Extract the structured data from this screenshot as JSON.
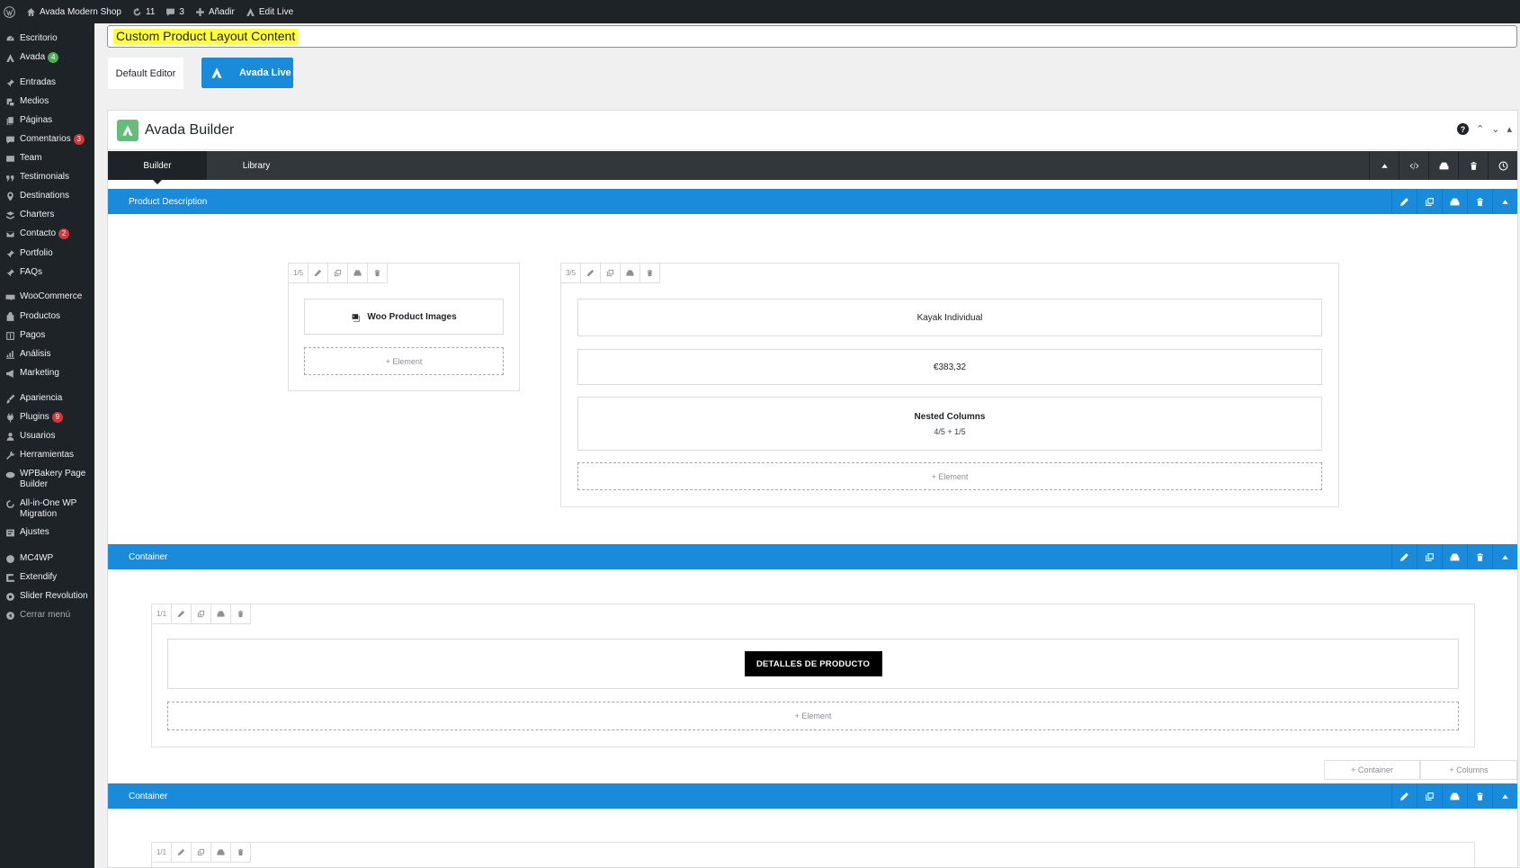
{
  "adminbar": {
    "site_name": "Avada Modern Shop",
    "updates_count": "11",
    "comments_count": "3",
    "add_label": "Añadir",
    "edit_live_label": "Edit Live"
  },
  "sidebar": {
    "items": [
      {
        "label": "Escritorio",
        "icon": "dashboard-icon"
      },
      {
        "label": "Avada",
        "icon": "avada-icon",
        "badge": "4"
      },
      {
        "label": "Entradas",
        "icon": "pin-icon"
      },
      {
        "label": "Medios",
        "icon": "media-icon"
      },
      {
        "label": "Páginas",
        "icon": "pages-icon"
      },
      {
        "label": "Comentarios",
        "icon": "comment-icon",
        "badge": "3"
      },
      {
        "label": "Team",
        "icon": "team-icon"
      },
      {
        "label": "Testimonials",
        "icon": "quote-icon"
      },
      {
        "label": "Destinations",
        "icon": "location-icon"
      },
      {
        "label": "Charters",
        "icon": "charter-icon"
      },
      {
        "label": "Contacto",
        "icon": "mail-icon",
        "badge": "2"
      },
      {
        "label": "Portfolio",
        "icon": "pin-icon"
      },
      {
        "label": "FAQs",
        "icon": "pin-icon"
      },
      {
        "label": "WooCommerce",
        "icon": "woo-icon"
      },
      {
        "label": "Productos",
        "icon": "products-icon"
      },
      {
        "label": "Pagos",
        "icon": "payments-icon"
      },
      {
        "label": "Análisis",
        "icon": "chart-icon"
      },
      {
        "label": "Marketing",
        "icon": "megaphone-icon"
      },
      {
        "label": "Apariencia",
        "icon": "brush-icon"
      },
      {
        "label": "Plugins",
        "icon": "plugin-icon",
        "badge": "9"
      },
      {
        "label": "Usuarios",
        "icon": "user-icon"
      },
      {
        "label": "Herramientas",
        "icon": "wrench-icon"
      },
      {
        "label": "WPBakery Page Builder",
        "icon": "wpbakery-icon"
      },
      {
        "label": "All-in-One WP Migration",
        "icon": "migration-icon"
      },
      {
        "label": "Ajustes",
        "icon": "settings-icon"
      },
      {
        "label": "MC4WP",
        "icon": "mc4wp-icon"
      },
      {
        "label": "Extendify",
        "icon": "extendify-icon"
      },
      {
        "label": "Slider Revolution",
        "icon": "slider-icon"
      },
      {
        "label": "Cerrar menú",
        "icon": "collapse-icon"
      }
    ]
  },
  "title_field": {
    "value": "Custom Product Layout Content"
  },
  "editor_buttons": {
    "default_label": "Default Editor",
    "live_label": "Avada Live"
  },
  "builder": {
    "title": "Avada Builder",
    "tabs": [
      {
        "label": "Builder"
      },
      {
        "label": "Library"
      }
    ],
    "sections": [
      {
        "title": "Product Description",
        "columns": [
          {
            "size": "1/5",
            "elements": [
              {
                "label": "Woo Product Images"
              }
            ],
            "add_label": "+ Element"
          },
          {
            "size": "3/5",
            "elements": [
              {
                "label": "Kayak Individual"
              },
              {
                "label": "€383,32"
              },
              {
                "label": "Nested Columns",
                "sub": "4/5 + 1/5"
              }
            ],
            "add_label": "+ Element"
          }
        ]
      },
      {
        "title": "Container",
        "columns": [
          {
            "size": "1/1",
            "elements": [
              {
                "label": "DETALLES DE PRODUCTO"
              }
            ],
            "add_label": "+ Element"
          }
        ],
        "footer_buttons": {
          "add_container": "+ Container",
          "add_columns": "+ Columns"
        }
      },
      {
        "title": "Container",
        "columns": [
          {
            "size": "1/1"
          }
        ]
      }
    ]
  },
  "colors": {
    "admin_dark": "#1d2327",
    "builder_blue": "#1a8bdb",
    "highlight": "#ffff3d",
    "avada_green": "#65bc7b"
  }
}
